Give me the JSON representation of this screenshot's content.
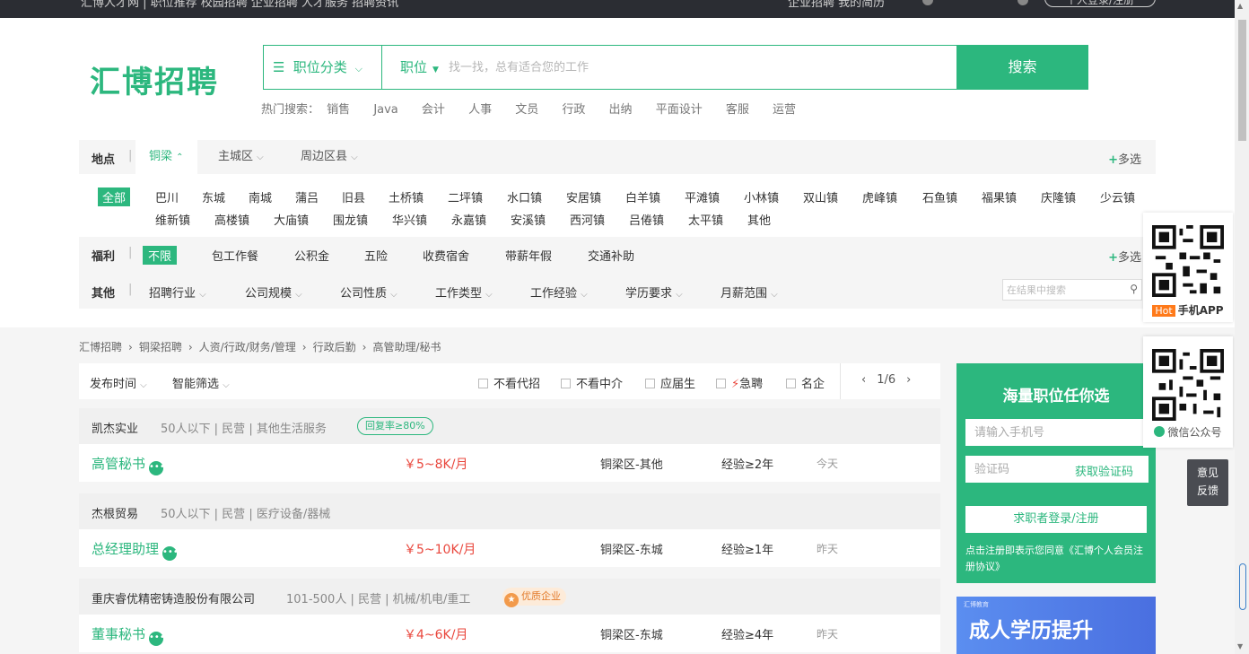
{
  "topbar": {
    "left_text": "汇博人才网  |  职位推荐  校园招聘  企业招聘  人才服务  招聘资讯",
    "right_text": "企业招聘  我的简历",
    "pill": "个人登录/注册"
  },
  "logo": "汇博招聘",
  "search": {
    "category_label": "职位分类",
    "type_label": "职位",
    "placeholder": "找一找，总有适合您的工作",
    "button": "搜索",
    "hot_label": "热门搜索：",
    "hot_terms": [
      "销售",
      "Java",
      "会计",
      "人事",
      "文员",
      "行政",
      "出纳",
      "平面设计",
      "客服",
      "运营"
    ]
  },
  "location_filter": {
    "label": "地点",
    "tabs": [
      "铜梁",
      "主城区",
      "周边区县"
    ],
    "more": "多选",
    "towns": [
      "全部",
      "巴川",
      "东城",
      "南城",
      "蒲吕",
      "旧县",
      "土桥镇",
      "二坪镇",
      "水口镇",
      "安居镇",
      "白羊镇",
      "平滩镇",
      "小林镇",
      "双山镇",
      "虎峰镇",
      "石鱼镇",
      "福果镇",
      "庆隆镇",
      "少云镇",
      "维新镇",
      "高楼镇",
      "大庙镇",
      "围龙镇",
      "华兴镇",
      "永嘉镇",
      "安溪镇",
      "西河镇",
      "吕倦镇",
      "太平镇",
      "其他"
    ]
  },
  "welfare_filter": {
    "label": "福利",
    "active": "不限",
    "items": [
      "包工作餐",
      "公积金",
      "五险",
      "收费宿舍",
      "带薪年假",
      "交通补助"
    ],
    "more": "多选"
  },
  "other_filter": {
    "label": "其他",
    "items": [
      "招聘行业",
      "公司规模",
      "公司性质",
      "工作类型",
      "工作经验",
      "学历要求",
      "月薪范围"
    ],
    "search_placeholder": "在结果中搜索"
  },
  "breadcrumb": [
    "汇博招聘",
    "铜梁招聘",
    "人资/行政/财务/管理",
    "行政后勤",
    "高管助理/秘书"
  ],
  "list_header": {
    "sort": [
      "发布时间",
      "智能筛选"
    ],
    "checks": [
      "不看代招",
      "不看中介",
      "应届生",
      "急聘",
      "名企"
    ],
    "page": "1/6"
  },
  "jobs": [
    {
      "company": "凯杰实业",
      "info": "50人以下 | 民营 | 其他生活服务",
      "badge": "回复率≥80%",
      "title": "高管秘书",
      "salary": "￥5~8K/月",
      "location": "铜梁区-其他",
      "experience": "经验≥2年",
      "time": "今天"
    },
    {
      "company": "杰根贸易",
      "info": "50人以下 | 民营 | 医疗设备/器械",
      "badge": "",
      "title": "总经理助理",
      "salary": "￥5~10K/月",
      "location": "铜梁区-东城",
      "experience": "经验≥1年",
      "time": "昨天"
    },
    {
      "company": "重庆睿优精密铸造股份有限公司",
      "info": "101-500人 | 民营 | 机械/机电/重工",
      "badge": "优质企业",
      "title": "董事秘书",
      "salary": "￥4~6K/月",
      "location": "铜梁区-东城",
      "experience": "经验≥4年",
      "time": "昨天"
    }
  ],
  "register": {
    "title": "海量职位任你选",
    "phone_placeholder": "请输入手机号",
    "code_placeholder": "验证码",
    "get_code": "获取验证码",
    "login": "求职者登录/注册",
    "agreement": "点击注册即表示您同意《汇博个人会员注册协议》"
  },
  "banner": {
    "small": "汇博教育",
    "big": "成人学历提升"
  },
  "float": {
    "app_hot": "Hot",
    "app_label": "手机APP",
    "wechat_label": "微信公众号",
    "feedback_1": "意见",
    "feedback_2": "反馈"
  },
  "colors": {
    "brand": "#2cb77e",
    "salary": "#e9473d"
  }
}
